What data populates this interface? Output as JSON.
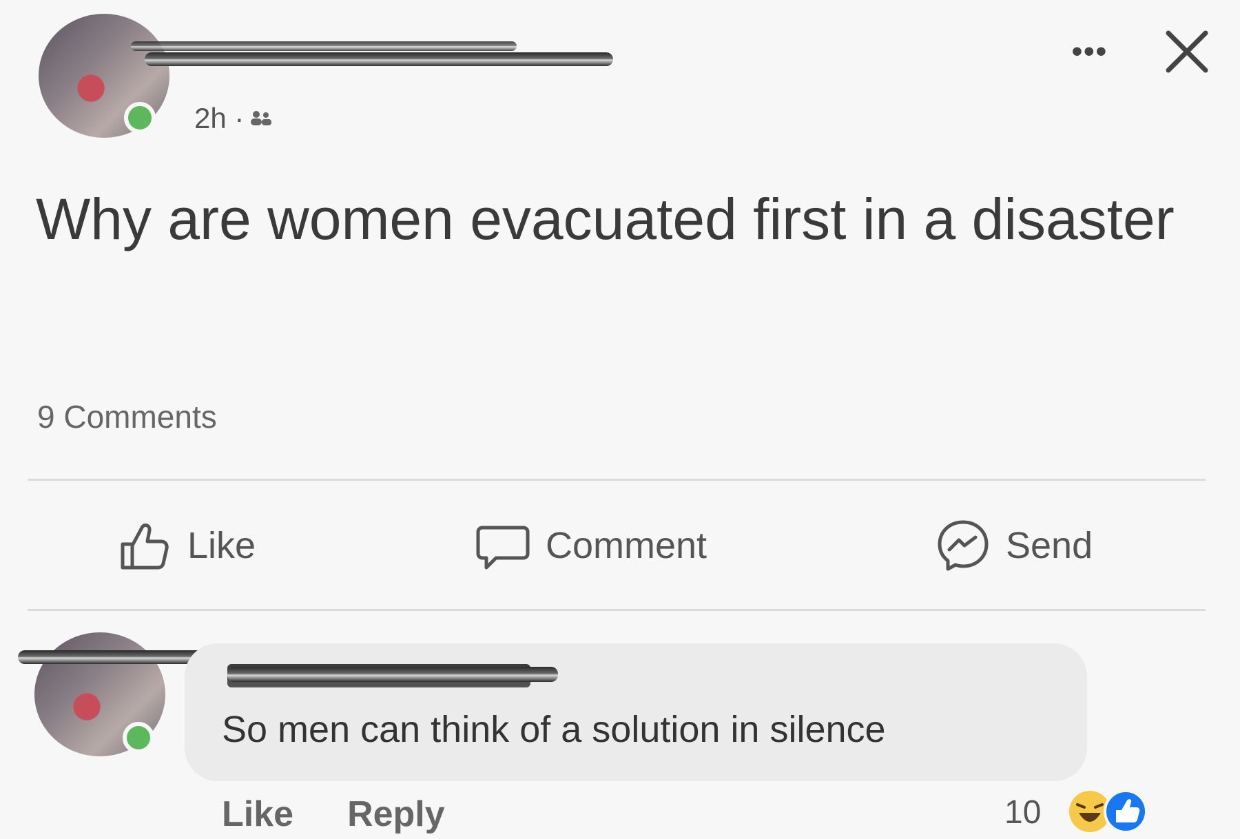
{
  "post": {
    "timestamp": "2h ·",
    "audience_icon": "friends-icon",
    "text": "Why are women evacuated first in a disaster",
    "comments_count": "9 Comments"
  },
  "header_actions": {
    "more_icon": "more-options-icon",
    "more_label": "•••",
    "close_icon": "close-icon"
  },
  "actions": {
    "like": "Like",
    "comment": "Comment",
    "send": "Send"
  },
  "comment": {
    "text": "So men can think of a solution in silence",
    "like": "Like",
    "reply": "Reply",
    "reaction_count": "10"
  },
  "colors": {
    "online": "#5cb85c",
    "bubble": "#ebebec",
    "like_blue": "#1877f2",
    "haha_yellow": "#f7c948"
  }
}
